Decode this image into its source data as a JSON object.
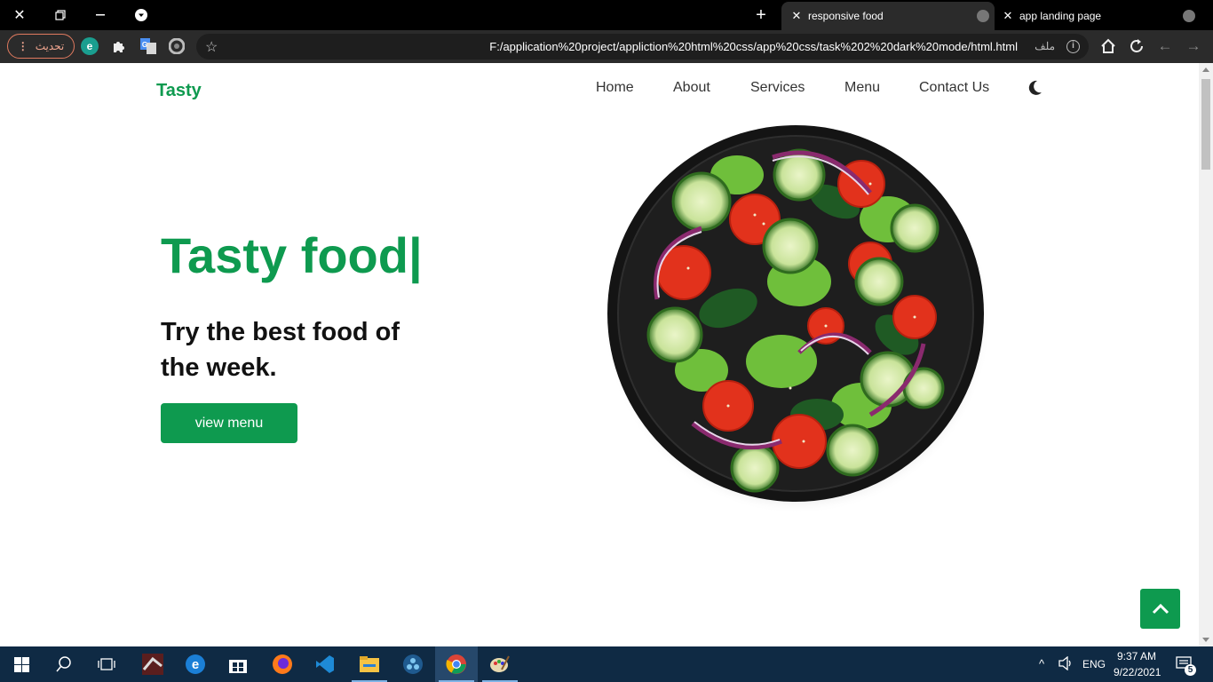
{
  "browser": {
    "tabs": [
      {
        "title": "responsive food",
        "active": true
      },
      {
        "title": "app landing page",
        "active": false
      }
    ],
    "update_button": "تحديث",
    "address": {
      "url": "F:/application%20project/appliction%20html%20css/app%20css/task%202%20dark%20mode/html.html",
      "scheme_label": "ملف"
    }
  },
  "page": {
    "logo": "Tasty",
    "nav": [
      "Home",
      "About",
      "Services",
      "Menu",
      "Contact Us"
    ],
    "hero": {
      "title": "Tasty food|",
      "subtitle": "Try the best food of the week.",
      "button": "view menu"
    }
  },
  "taskbar": {
    "language": "ENG",
    "time": "9:37 AM",
    "date": "9/22/2021",
    "notifications": "5"
  },
  "colors": {
    "brand": "#0e9a4f",
    "chrome_dark": "#2b2b2b",
    "taskbar": "#0f2a44"
  }
}
